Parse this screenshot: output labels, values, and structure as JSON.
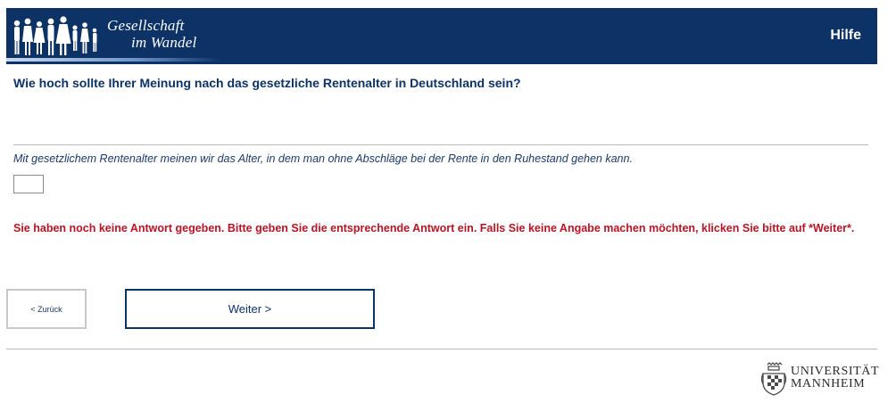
{
  "header": {
    "logo_line1": "Gesellschaft",
    "logo_line2": "im Wandel",
    "help_label": "Hilfe",
    "background_color": "#0d3266"
  },
  "question": {
    "text": "Wie hoch sollte Ihrer Meinung nach das gesetzliche Rentenalter in Deutschland sein?",
    "explanation": "Mit gesetzlichem Rentenalter meinen wir das Alter, in dem man ohne Abschläge bei der Rente in den Ruhestand gehen kann.",
    "answer_value": ""
  },
  "error": {
    "text": "Sie haben noch keine Antwort gegeben. Bitte geben Sie die entsprechende Antwort ein. Falls Sie keine Angabe machen möchten, klicken Sie bitte auf *Weiter*.",
    "color": "#b81424"
  },
  "navigation": {
    "back_label": "< Zurück",
    "next_label": "Weiter >"
  },
  "footer": {
    "university_line1": "UNIVERSITÄT",
    "university_line2": "MANNHEIM",
    "crest_icon": "university-crest-icon"
  }
}
